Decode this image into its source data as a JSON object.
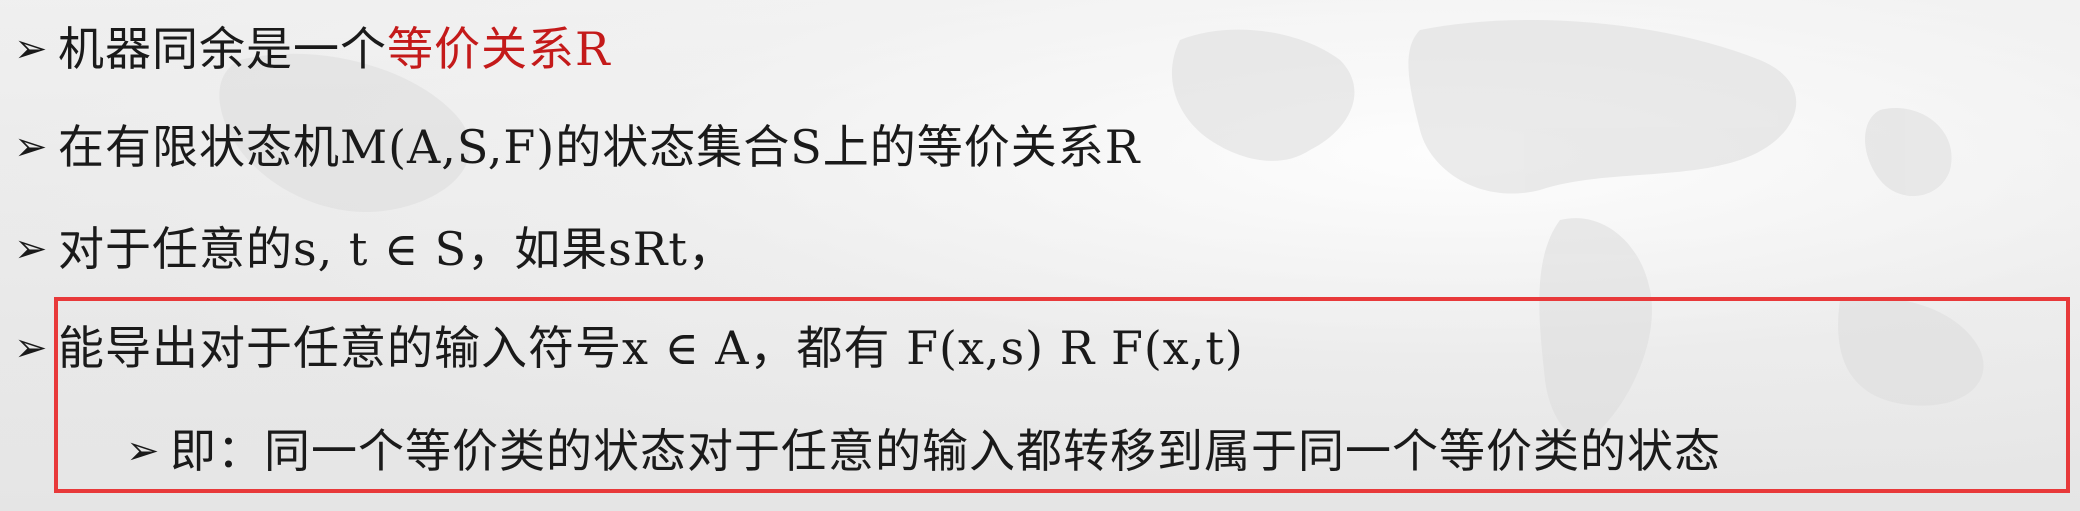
{
  "bullet_glyph": "➢",
  "lines": {
    "l1": {
      "text": "机器同余是一个",
      "red": "等价关系R"
    },
    "l2": {
      "text": "在有限状态机M(A,S,F)的状态集合S上的等价关系R"
    },
    "l3": {
      "text": "对于任意的s, t ∈ S，如果sRt，"
    },
    "l4": {
      "text": "能导出对于任意的输入符号x ∈ A，都有 F(x,s) R F(x,t)"
    },
    "l5": {
      "text": "即：同一个等价类的状态对于任意的输入都转移到属于同一个等价类的状态"
    }
  },
  "colors": {
    "highlight_text": "#c41a1a",
    "box_border": "#e8393a"
  }
}
